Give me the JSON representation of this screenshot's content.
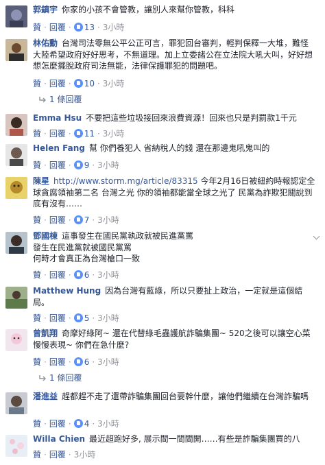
{
  "actions": {
    "like": "贊",
    "reply": "回覆",
    "dot": "·"
  },
  "comments": [
    {
      "name": "郭鎮宇",
      "text": "你家的小孩不會管教，讓別人來幫你管教，科科",
      "likes": "13",
      "time": "3小時"
    },
    {
      "name": "林佑勳",
      "text": "台灣司法零無公平公正可言，罪犯回台審判，輕判保釋一大堆，難怪大陸希望政府好好思考，不無道理。加上立委諸公在立法院大吼大叫，好好想想怎麼擺脫政府司法無能，法律保護罪犯的問題吧。",
      "likes": "10",
      "time": "3小時",
      "replies": "1 條回覆"
    },
    {
      "name": "Emma Hsu",
      "text": "不要把這些垃圾接回來浪費資源！回來也只是判罰款1千元",
      "likes": "11",
      "time": "3小時"
    },
    {
      "name": "Helen Fang",
      "text": "幫 你們養犯人 省納稅人的錢 還在那邊鬼吼鬼叫的",
      "likes": "9",
      "time": "3小時"
    },
    {
      "name": "陳星",
      "link": "http://www.storm.mg/article/83315",
      "text": " 今年2月16日被紐約時報認定全球貪腐領袖第二名 台灣之光 你的領袖都能當全球之光了 民黨為詐欺犯關說到底有沒有……",
      "likes": "7",
      "time": "3小時"
    },
    {
      "name": "鄧國棟",
      "text": "這事發生在國民黨執政就被民進黨罵",
      "line2": "發生在民進黨就被國民黨罵",
      "line3": "何時才會真正為台灣槍口一致",
      "likes": "6",
      "time": "3小時"
    },
    {
      "name": "Matthew Hung",
      "text": "因為台灣有藍綠，所以只要扯上政治，一定就是這個結局。",
      "likes": "5",
      "time": "3小時"
    },
    {
      "name": "曾凱翔",
      "text": "奇摩好綠阿~ 還在代替綠毛蟲護航詐騙集團~ 520之後可以讓空心菜慢慢表現~ 你們在急什麼?",
      "likes": "6",
      "time": "3小時",
      "replies": "1 條回覆"
    },
    {
      "name": "潘進益",
      "text": "趕都趕不走了還帶詐騙集團回台要幹什麼，讓他們繼續在台灣詐騙嗎",
      "likes": "4",
      "time": "3小時"
    },
    {
      "name": "Willa Chien",
      "text": "最近超跑好多, 展示間一間間開……有些是詐騙集團買的八",
      "likes": "",
      "time": "3小時"
    }
  ]
}
